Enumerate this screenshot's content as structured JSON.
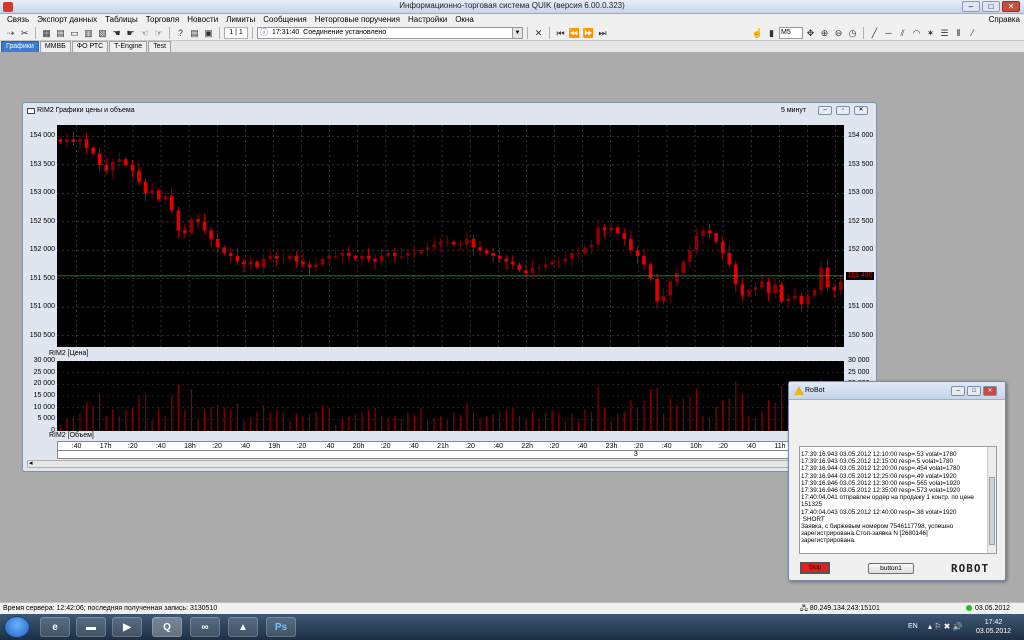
{
  "app": {
    "title": "Информационно-торговая система QUIK (версия 6.00.0.323)"
  },
  "menu": {
    "items": [
      "Связь",
      "Экспорт данных",
      "Таблицы",
      "Торговля",
      "Новости",
      "Лимиты",
      "Сообщения",
      "Неторговые поручения",
      "Настройки",
      "Окна"
    ],
    "help": "Справка"
  },
  "toolbar": {
    "page": "1 | 1",
    "status_time": "17:31:40",
    "status_text": "Соединение установлено",
    "interval": "M5"
  },
  "tabs": [
    "Графики",
    "ММВБ",
    "ФО РТС",
    "T-Engine",
    "Test"
  ],
  "chart_window": {
    "title": "RIM2 Графики цены и объема",
    "interval": "5 минут",
    "price_legend": "RIM2 [Цена]",
    "volume_legend": "RIM2 [Объем]",
    "current_price_label": "151 480"
  },
  "chart_data": [
    {
      "type": "candlestick",
      "yticks": [
        "154 000",
        "153 500",
        "153 000",
        "152 500",
        "152 000",
        "151 500",
        "151 000",
        "150 500"
      ],
      "ylim": [
        150300,
        154200
      ],
      "current_level": 151550,
      "xticks": [
        ":40",
        "17h",
        ":20",
        ":40",
        "18h",
        ":20",
        ":40",
        "19h",
        ":20",
        ":40",
        "20h",
        ":20",
        ":40",
        "21h",
        ":20",
        ":40",
        "22h",
        ":20",
        ":40",
        "23h",
        ":20",
        ":40",
        "10h",
        ":20",
        ":40",
        "11h",
        ":20",
        ":40"
      ],
      "date_marker": "3",
      "close": [
        153900,
        153950,
        153900,
        153950,
        153800,
        153700,
        153500,
        153400,
        153550,
        153600,
        153500,
        153400,
        153200,
        153000,
        153050,
        152900,
        152950,
        152700,
        152350,
        152300,
        152550,
        152500,
        152350,
        152200,
        152050,
        151950,
        151900,
        151800,
        151750,
        151800,
        151700,
        151850,
        151900,
        151850,
        151850,
        151900,
        151800,
        151750,
        151700,
        151750,
        151850,
        151900,
        151900,
        151950,
        151900,
        151850,
        151900,
        151850,
        151800,
        151900,
        151950,
        151900,
        151900,
        151950,
        151950,
        152000,
        152050,
        152100,
        152150,
        152150,
        152100,
        152100,
        152200,
        152050,
        152000,
        151950,
        151900,
        151850,
        151800,
        151750,
        151650,
        151600,
        151700,
        151700,
        151750,
        151800,
        151800,
        151850,
        151950,
        151950,
        152050,
        152100,
        152400,
        152350,
        152400,
        152300,
        152200,
        152000,
        151900,
        151750,
        151500,
        151100,
        151200,
        151450,
        151600,
        151800,
        152000,
        152250,
        152350,
        152300,
        152150,
        151950,
        151750,
        151400,
        151200,
        151300,
        151350,
        151450,
        151250,
        151400,
        151100,
        151150,
        151200,
        151050,
        151200,
        151300,
        151700,
        151350,
        151300,
        151450
      ],
      "volume_ylim": [
        0,
        30000
      ],
      "volume_yticks": [
        "30 000",
        "25 000",
        "20 000",
        "15 000",
        "10 000",
        "5 000",
        "0"
      ]
    }
  ],
  "robot": {
    "title": "RoBot",
    "log": [
      "17:39:16.943 03.05.2012 12:10:00 resp=.53 volat=1780",
      "17:39:16.943 03.05.2012 12:15:00 resp=.5 volat=1780",
      "17:39:16.944 03.05.2012 12:20:00 resp=.454 volat=1780",
      "17:39:16.944 03.05.2012 12:25:00 resp=.49 volat=1920",
      "17:39:16.946 03.05.2012 12:30:00 resp=.565 volat=1920",
      "17:39:16.946 03.05.2012 12:35:00 resp=.573 volat=1920",
      "17:40:04.041 отправлен ордер на продажу 1 контр. по цене",
      "151325",
      "17:40:04.043 03.05.2012 12:40:00 resp=.38 volat=1920",
      " SHORT",
      "Заявка, с биржевым номером 7546117798, успешно",
      "зарегистрирована.Стоп-заявка N [2680146]",
      "зарегистрирована."
    ],
    "stop_label": "Stop",
    "button1_label": "button1",
    "brand": "ROBOT"
  },
  "statusbar": {
    "left": "Время сервера: 12:42:06; последняя полученная запись: 3130510",
    "ip": "80.249.134.243:15101",
    "date": "03.05.2012"
  },
  "taskbar": {
    "lang": "EN",
    "time": "17:42",
    "date": "03.05.2012"
  },
  "colors": {
    "bear": "#e00000",
    "bull": "#8b0000",
    "volume": "#8b0000",
    "current_line": "#2ea82e"
  }
}
